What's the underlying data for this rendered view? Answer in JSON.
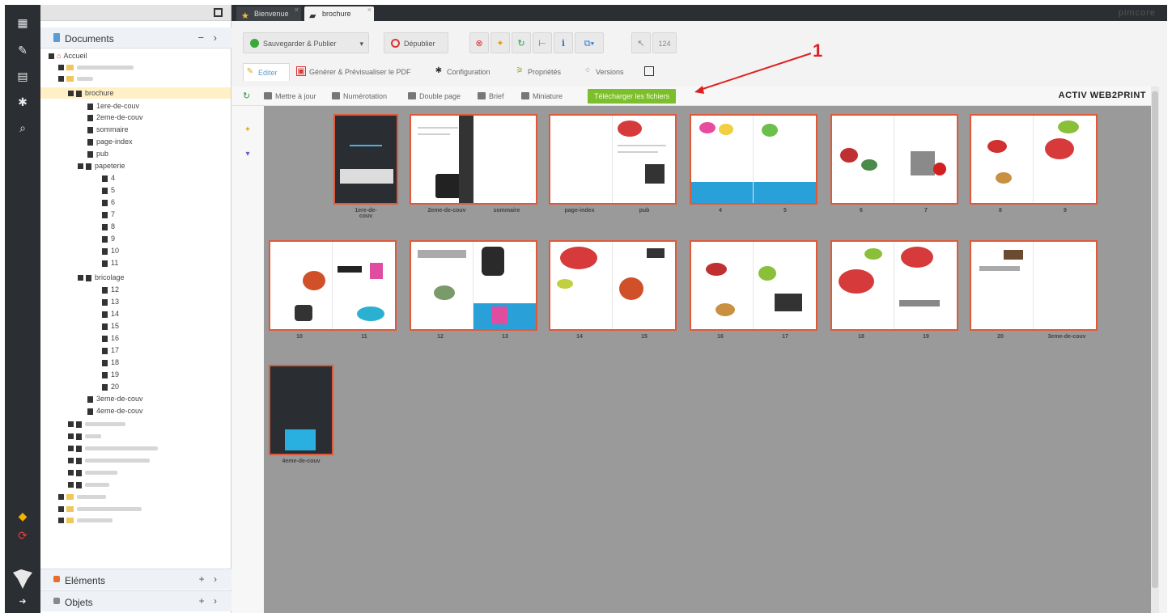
{
  "tabs": [
    {
      "label": "Bienvenue",
      "icon": "star-icon"
    },
    {
      "label": "brochure",
      "icon": "book-icon"
    }
  ],
  "brand": "pimcore",
  "tree": {
    "header": "Documents",
    "root": "Accueil",
    "selected": "brochure",
    "items": [
      "1ere-de-couv",
      "2eme-de-couv",
      "sommaire",
      "page-index",
      "pub"
    ],
    "papeterie": {
      "label": "papeterie",
      "pages": [
        "4",
        "5",
        "6",
        "7",
        "8",
        "9",
        "10",
        "11"
      ]
    },
    "bricolage": {
      "label": "bricolage",
      "pages": [
        "12",
        "13",
        "14",
        "15",
        "16",
        "17",
        "18",
        "19",
        "20"
      ]
    },
    "tail": [
      "3eme-de-couv",
      "4eme-de-couv"
    ]
  },
  "bottom_panels": [
    "Eléments",
    "Objets"
  ],
  "toolbar": {
    "save_publish": "Sauvegarder & Publier",
    "unpublish": "Dépublier",
    "counter": "124"
  },
  "doc_tabs": [
    "Editer",
    "Générer & Prévisualiser le PDF",
    "Configuration",
    "Propriétés",
    "Versions"
  ],
  "edit_toolbar": {
    "update": "Mettre à jour",
    "numbering": "Numérotation",
    "double_page": "Double page",
    "brief": "Brief",
    "thumbnail": "Miniature",
    "download": "Télécharger les fichiers"
  },
  "logo_text": "ACTIV WEB2PRINT",
  "annotation_number": "1",
  "spreads": [
    [
      "1ere-de-couv"
    ],
    [
      "2eme-de-couv",
      "sommaire"
    ],
    [
      "page-index",
      "pub"
    ],
    [
      "4",
      "5"
    ],
    [
      "6",
      "7"
    ],
    [
      "8",
      "9"
    ],
    [
      "10",
      "11"
    ],
    [
      "12",
      "13"
    ],
    [
      "14",
      "15"
    ],
    [
      "16",
      "17"
    ],
    [
      "18",
      "19"
    ],
    [
      "20",
      "3eme-de-couv"
    ],
    [
      "4eme-de-couv"
    ]
  ],
  "colors": {
    "accent": "#7cbe2c",
    "border": "#e05a3a",
    "dark": "#2b2e32",
    "annotation": "#e02020"
  }
}
